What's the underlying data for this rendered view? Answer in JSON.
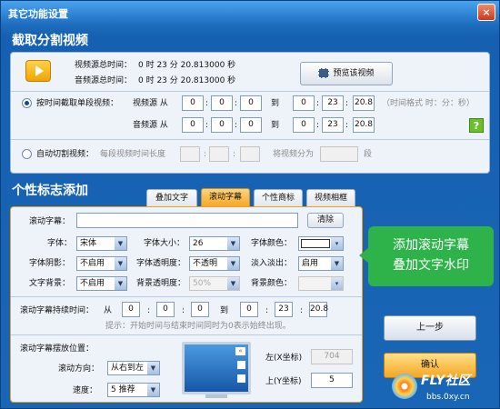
{
  "window": {
    "title": "其它功能设置",
    "close": "×"
  },
  "section1": {
    "title": "截取分割视频",
    "video_total_label": "视频源总时间：",
    "video_total_value": "0  时 23  分 20.813000 秒",
    "audio_total_label": "音频源总时间：",
    "audio_total_value": "0  时 23  分 20.813000 秒",
    "preview_button": "预览该视频",
    "by_time_label": "按时间截取单段视频：",
    "video_src_label": "视频源  从",
    "audio_src_label": "音频源  从",
    "video_from": [
      "0",
      "0",
      "0"
    ],
    "video_to": [
      "0",
      "23",
      "20.8"
    ],
    "audio_from": [
      "0",
      "0",
      "0"
    ],
    "audio_to": [
      "0",
      "23",
      "20.8"
    ],
    "to_label": "到",
    "time_format_hint": "（时间格式 时：分：秒）",
    "help": "?",
    "auto_cut_label": "自动切割视频：",
    "segment_len_label": "每段视频时间长度",
    "divide_label": "将视频分为",
    "segment_unit": "段",
    "colon": ":"
  },
  "section2": {
    "title": "个性标志添加",
    "tabs": [
      "叠加文字",
      "滚动字幕",
      "个性商标",
      "视频相框"
    ],
    "scroll_text_label": "滚动字幕：",
    "scroll_text_value": "",
    "clear_button": "清除",
    "font_label": "字体：",
    "font_value": "宋体",
    "font_size_label": "字体大小：",
    "font_size_value": "26",
    "font_color_label": "字体颜色：",
    "shadow_label": "字体阴影：",
    "shadow_value": "不启用",
    "opacity_label": "字体透明度：",
    "opacity_value": "不透明",
    "fade_label": "淡入淡出：",
    "fade_value": "启用",
    "bg_label": "文字背景：",
    "bg_value": "不启用",
    "bg_opacity_label": "背景透明度：",
    "bg_opacity_value": "50%",
    "bg_color_label": "背景颜色：",
    "duration_label": "滚动字幕持续时间：",
    "from_label": "从",
    "to_label": "到",
    "dur_from": [
      "0",
      "0",
      "0"
    ],
    "dur_to": [
      "0",
      "23",
      "20.8"
    ],
    "dur_hint": "提示：开始时间与结束时间同时为0表示始终出现。",
    "position_label": "滚动字幕摆放位置：",
    "direction_label": "滚动方向：",
    "direction_value": "从右到左",
    "speed_label": "速度：",
    "speed_value": "5 推荐",
    "left_label": "左(X坐标)",
    "left_value": "704",
    "top_label": "上(Y坐标)",
    "top_value": "5"
  },
  "callout": {
    "line1": "添加滚动字幕",
    "line2": "叠加文字水印"
  },
  "buttons": {
    "prev": "上一步",
    "confirm": "确认"
  },
  "watermark": {
    "brand": "FLY社区",
    "url": "bbs.0xy.cn"
  },
  "colors": {
    "accent": "#1a66b6",
    "tab_active": "#f5a623",
    "callout": "#2db34a"
  }
}
